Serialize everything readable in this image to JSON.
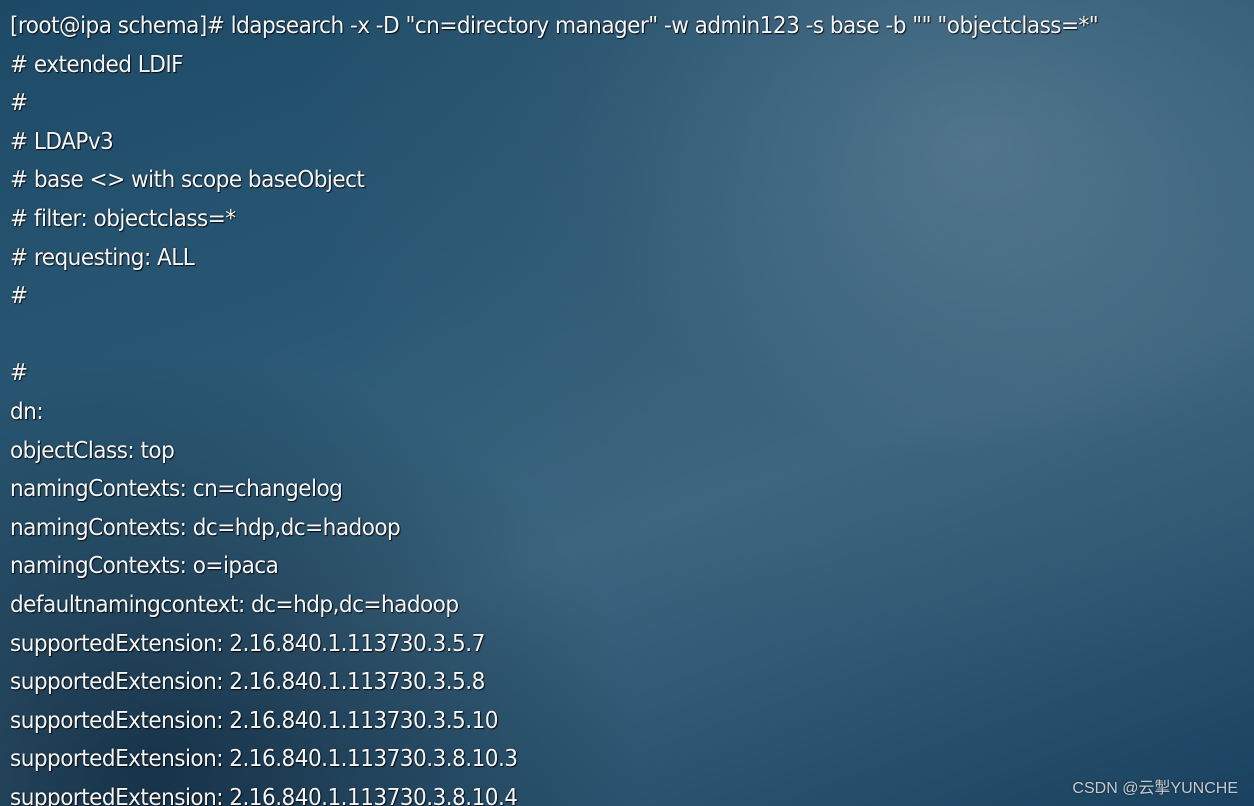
{
  "terminal": {
    "lines": [
      "[root@ipa schema]# ldapsearch -x -D \"cn=directory manager\" -w admin123 -s base -b \"\" \"objectclass=*\"",
      "# extended LDIF",
      "#",
      "# LDAPv3",
      "# base <> with scope baseObject",
      "# filter: objectclass=*",
      "# requesting: ALL",
      "#",
      "",
      "#",
      "dn:",
      "objectClass: top",
      "namingContexts: cn=changelog",
      "namingContexts: dc=hdp,dc=hadoop",
      "namingContexts: o=ipaca",
      "defaultnamingcontext: dc=hdp,dc=hadoop",
      "supportedExtension: 2.16.840.1.113730.3.5.7",
      "supportedExtension: 2.16.840.1.113730.3.5.8",
      "supportedExtension: 2.16.840.1.113730.3.5.10",
      "supportedExtension: 2.16.840.1.113730.3.8.10.3",
      "supportedExtension: 2.16.840.1.113730.3.8.10.4"
    ]
  },
  "watermark": "CSDN @云掣YUNCHE"
}
